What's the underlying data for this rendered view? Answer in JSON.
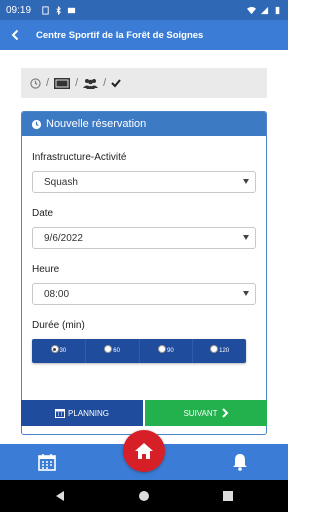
{
  "status_bar": {
    "time": "09:19",
    "icons_left": [
      "sim-icon",
      "bluetooth-icon",
      "photo-icon"
    ],
    "icons_right": [
      "wifi-icon",
      "signal-icon",
      "battery-icon"
    ]
  },
  "app_bar": {
    "title": "Centre Sportif de la Forêt de Soignes",
    "back_icon": "back-arrow-icon"
  },
  "steps": {
    "items": [
      "clock-icon",
      "court-icon",
      "users-icon",
      "check-icon"
    ],
    "separator": "/"
  },
  "form": {
    "header": "Nouvelle réservation",
    "infra_label": "Infrastructure-Activité",
    "infra_value": "Squash",
    "date_label": "Date",
    "date_value": "9/6/2022",
    "heure_label": "Heure",
    "heure_value": "08:00",
    "duree_label": "Durée (min)",
    "duree_options": [
      "30",
      "60",
      "90",
      "120"
    ],
    "duree_selected": "30"
  },
  "buttons": {
    "planning": "PLANNING",
    "suivant": "SUIVANT"
  },
  "colors": {
    "primary": "#3b7dd6",
    "dark_blue": "#1f4c9c",
    "green": "#22b14c",
    "red": "#d61f26"
  }
}
